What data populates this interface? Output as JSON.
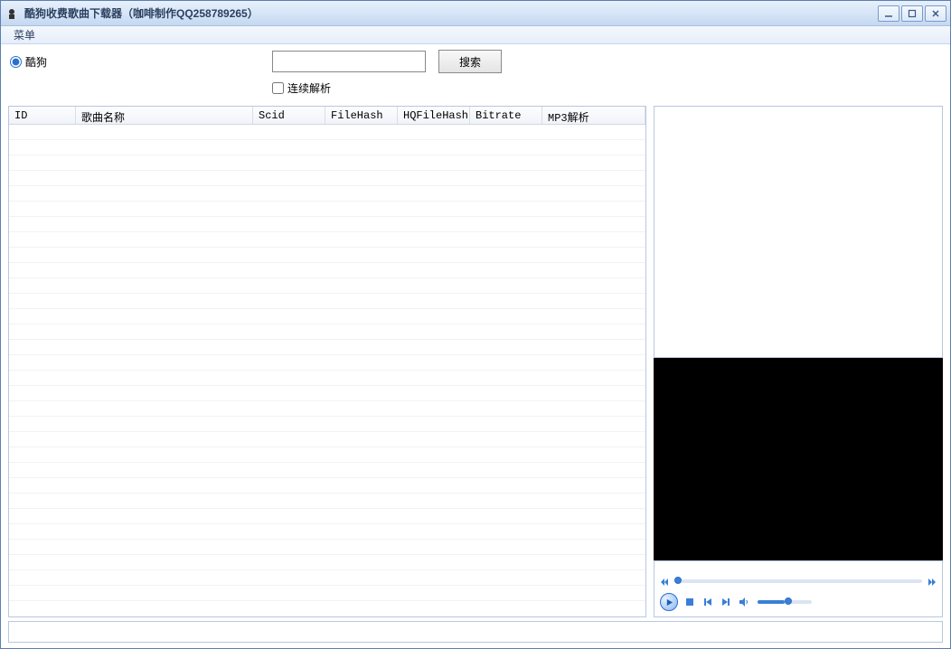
{
  "window": {
    "title": "酷狗收费歌曲下载器（咖啡制作QQ258789265）"
  },
  "menubar": {
    "menu_label": "菜单"
  },
  "source": {
    "kugou_label": "酷狗",
    "kugou_checked": true
  },
  "search": {
    "value": "",
    "button_label": "搜索",
    "continuous_parse_label": "连续解析",
    "continuous_parse_checked": false
  },
  "table": {
    "columns": {
      "id": "ID",
      "name": "歌曲名称",
      "scid": "Scid",
      "filehash": "FileHash",
      "hqfilehash": "HQFileHash",
      "bitrate": "Bitrate",
      "mp3": "MP3解析"
    },
    "rows": []
  },
  "player": {
    "volume_percent": 50
  },
  "statusbar": {
    "text": ""
  }
}
